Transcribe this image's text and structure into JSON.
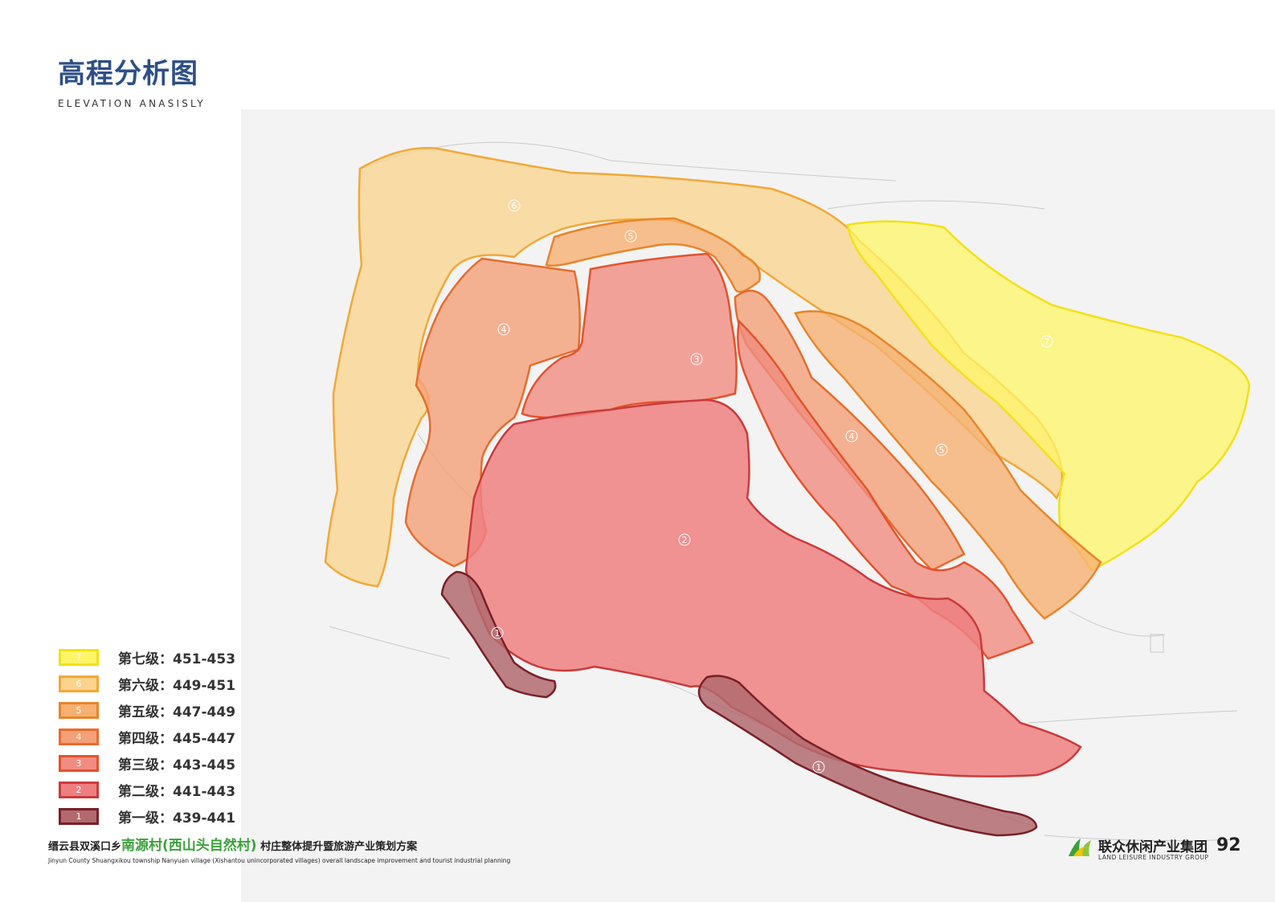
{
  "title": {
    "cn": "高程分析图",
    "en": "ELEVATION ANASISLY"
  },
  "legend": [
    {
      "num": "7",
      "label": "第七级：451-453",
      "fill": "#fff566",
      "stroke": "#f2e11a"
    },
    {
      "num": "6",
      "label": "第六级：449-451",
      "fill": "#fbd38c",
      "stroke": "#f1a838"
    },
    {
      "num": "5",
      "label": "第五级：447-449",
      "fill": "#f5b072",
      "stroke": "#e8852b"
    },
    {
      "num": "4",
      "label": "第四级：445-447",
      "fill": "#f4a078",
      "stroke": "#e66c2e"
    },
    {
      "num": "3",
      "label": "第三级：443-445",
      "fill": "#f08c80",
      "stroke": "#e4522c"
    },
    {
      "num": "2",
      "label": "第二级：441-443",
      "fill": "#ee7f80",
      "stroke": "#c93b3b"
    },
    {
      "num": "1",
      "label": "第一级：439-441",
      "fill": "#b26a6e",
      "stroke": "#7a1f28"
    }
  ],
  "zone_labels": [
    "7",
    "6",
    "5",
    "4",
    "3",
    "2",
    "1"
  ],
  "footer": {
    "cn_prefix": "缙云县双溪口乡",
    "cn_highlight": "南源村(西山头自然村)",
    "cn_suffix": " 村庄整体提升暨旅游产业策划方案",
    "en": "Jinyun County Shuangxikou township Nanyuan village (Xishantou unincorporated villages) overall landscape improvement and tourist industrial planning"
  },
  "brand": {
    "cn": "联众休闲产业集团",
    "en": "LAND LEISURE INDUSTRY GROUP",
    "page": "92"
  }
}
